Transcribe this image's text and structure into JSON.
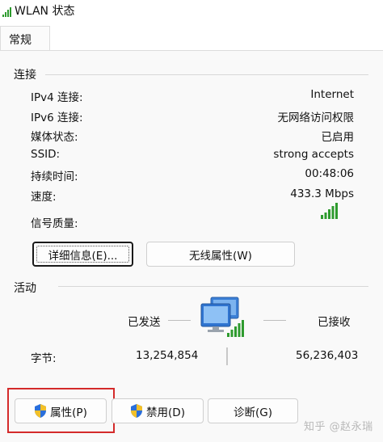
{
  "window": {
    "title": "WLAN 状态"
  },
  "tabs": [
    {
      "label": "常规"
    }
  ],
  "connection": {
    "section_label": "连接",
    "rows": [
      {
        "label": "IPv4 连接:",
        "value": "Internet"
      },
      {
        "label": "IPv6 连接:",
        "value": "无网络访问权限"
      },
      {
        "label": "媒体状态:",
        "value": "已启用"
      },
      {
        "label": "SSID:",
        "value": "strong accepts"
      },
      {
        "label": "持续时间:",
        "value": "00:48:06"
      },
      {
        "label": "速度:",
        "value": "433.3 Mbps"
      }
    ],
    "signal_label": "信号质量:",
    "signal_bars_filled": 5,
    "signal_bars_total": 5,
    "details_button": "详细信息(E)...",
    "wireless_props_button": "无线属性(W)"
  },
  "activity": {
    "section_label": "活动",
    "sent_label": "已发送",
    "received_label": "已接收",
    "bytes_label": "字节:",
    "bytes_sent": "13,254,854",
    "bytes_received": "56,236,403"
  },
  "bottom_buttons": {
    "properties": "属性(P)",
    "disable": "禁用(D)",
    "diagnose": "诊断(G)"
  },
  "watermark": "知乎 @赵永瑞",
  "colors": {
    "signal": "#2e9b2e",
    "highlight": "#d42a2a",
    "shield_blue": "#2a6fdb",
    "shield_yellow": "#f2c029"
  }
}
